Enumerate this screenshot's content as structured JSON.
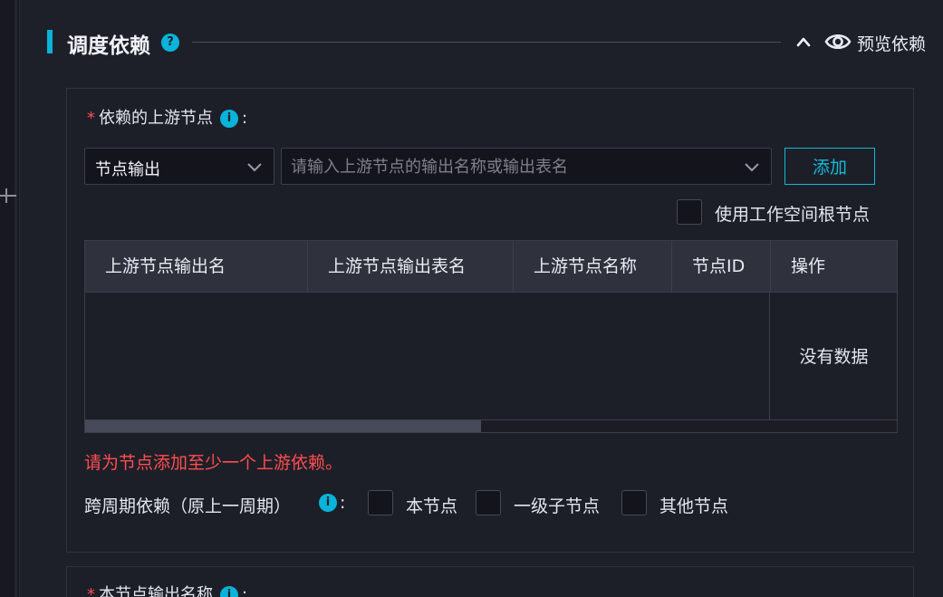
{
  "section": {
    "title": "调度依赖",
    "help_glyph": "?",
    "preview_label": "预览依赖"
  },
  "upstream": {
    "label": "依赖的上游节点",
    "required_mark": "*",
    "info_glyph": "i",
    "colon": ":",
    "type_select_value": "节点输出",
    "search_placeholder": "请输入上游节点的输出名称或输出表名",
    "add_button": "添加",
    "root_checkbox_label": "使用工作空间根节点",
    "table": {
      "columns": [
        "上游节点输出名",
        "上游节点输出表名",
        "上游节点名称",
        "节点ID",
        "操作"
      ],
      "empty_text": "没有数据"
    },
    "error_message": "请为节点添加至少一个上游依赖。",
    "cross_cycle": {
      "label": "跨周期依赖（原上一周期）",
      "colon": ":",
      "options": [
        "本节点",
        "一级子节点",
        "其他节点"
      ]
    }
  },
  "output": {
    "label": "本节点输出名称",
    "required_mark": "*",
    "info_glyph": "i",
    "colon": ":"
  },
  "icons": {
    "help": "help-icon",
    "chevron_up": "chevron-up-icon",
    "eye": "eye-icon",
    "info": "info-icon",
    "chevron_down": "chevron-down-icon"
  },
  "colors": {
    "accent": "#0ab3d9",
    "error": "#ff4d4f",
    "background": "#1e2029"
  }
}
